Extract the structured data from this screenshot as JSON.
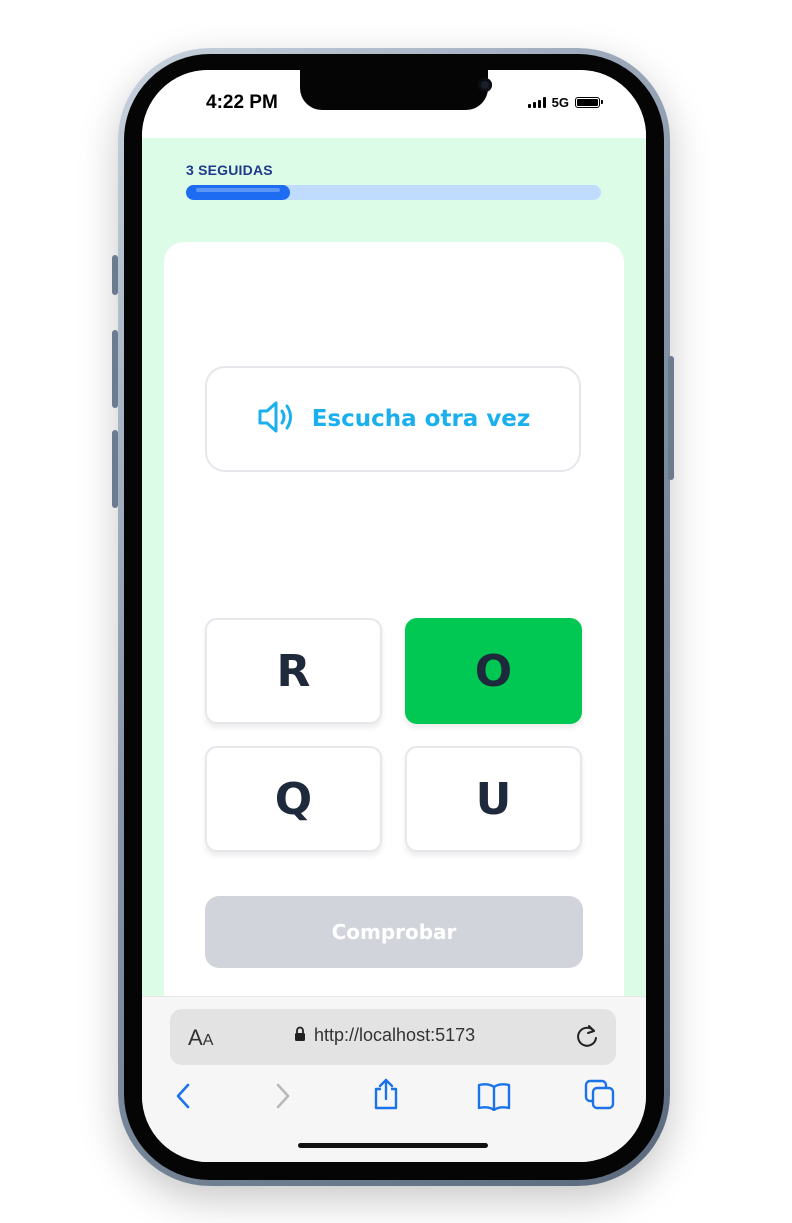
{
  "status_bar": {
    "time": "4:22 PM",
    "network": "5G"
  },
  "lesson": {
    "streak_label": "3 SEGUIDAS",
    "progress": 0.25,
    "listen_label": "Escucha otra vez",
    "options": [
      {
        "letter": "R",
        "selected": false
      },
      {
        "letter": "O",
        "selected": true
      },
      {
        "letter": "Q",
        "selected": false
      },
      {
        "letter": "U",
        "selected": false
      }
    ],
    "check_label": "Comprobar"
  },
  "browser": {
    "aa_big": "A",
    "aa_small": "A",
    "url": "http://localhost:5173"
  },
  "colors": {
    "background": "#dcfce7",
    "progress_fill": "#1d6cf2",
    "progress_track": "#bfdbfe",
    "listen_accent": "#1ab0ee",
    "selected_tile": "#00c853",
    "check_disabled": "#d1d5db",
    "tile_text": "#1e293b",
    "streak_text": "#1e3a8a"
  },
  "icons": {
    "listen": "speaker-icon",
    "secure": "lock-icon",
    "reload": "reload-icon",
    "back": "chevron-left-icon",
    "forward": "chevron-right-icon",
    "share": "share-icon",
    "bookmarks": "book-icon",
    "tabs": "tabs-icon"
  }
}
